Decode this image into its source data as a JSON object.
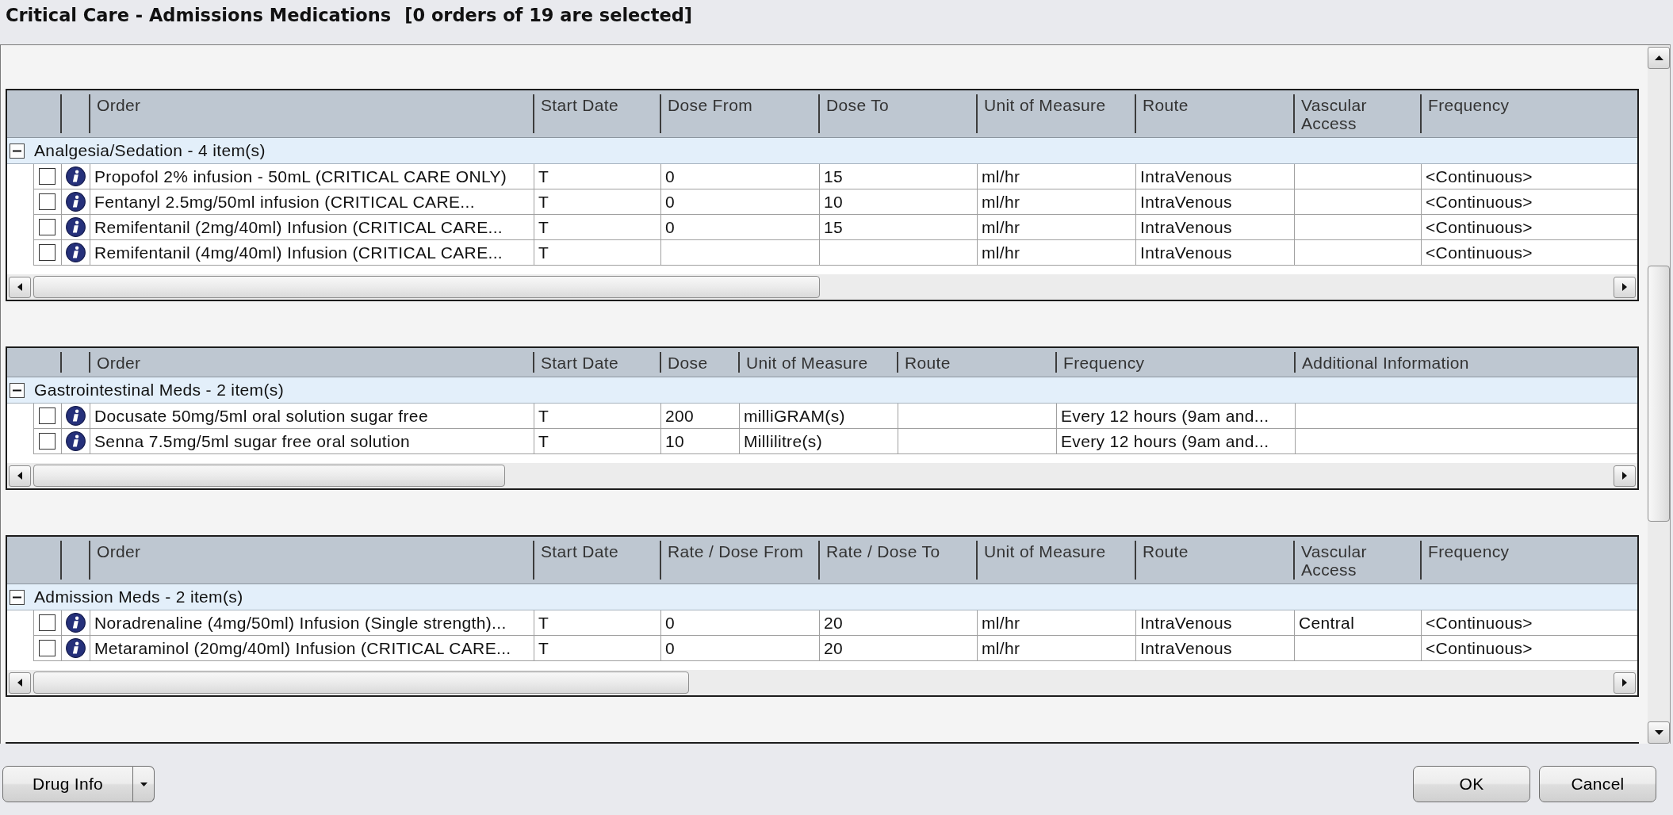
{
  "window": {
    "title": "Critical Care - Admissions Medications",
    "selection_summary": "[0 orders of 19 are selected]"
  },
  "order_tables": [
    {
      "columns": [
        "Order",
        "Start Date",
        "Dose From",
        "Dose To",
        "Unit of Measure",
        "Route",
        "Vascular Access",
        "Frequency"
      ],
      "group": {
        "label": "Analgesia/Sedation - 4 item(s)",
        "expanded": true
      },
      "rows": [
        {
          "checked": false,
          "cells": [
            "Propofol 2% infusion - 50mL (CRITICAL CARE ONLY)",
            "T",
            "0",
            "15",
            "ml/hr",
            "IntraVenous",
            null,
            "<Continuous>"
          ]
        },
        {
          "checked": false,
          "cells": [
            "Fentanyl 2.5mg/50ml infusion (CRITICAL CARE...",
            "T",
            "0",
            "10",
            "ml/hr",
            "IntraVenous",
            null,
            "<Continuous>"
          ]
        },
        {
          "checked": false,
          "cells": [
            "Remifentanil (2mg/40ml) Infusion (CRITICAL CARE...",
            "T",
            "0",
            "15",
            "ml/hr",
            "IntraVenous",
            null,
            "<Continuous>"
          ]
        },
        {
          "checked": false,
          "cells": [
            "Remifentanil (4mg/40ml) Infusion (CRITICAL CARE...",
            "T",
            null,
            null,
            "ml/hr",
            "IntraVenous",
            null,
            "<Continuous>"
          ]
        }
      ]
    },
    {
      "columns": [
        "Order",
        "Start Date",
        "Dose",
        "Unit of Measure",
        "Route",
        "Frequency",
        "Additional Information"
      ],
      "group": {
        "label": "Gastrointestinal Meds - 2 item(s)",
        "expanded": true
      },
      "rows": [
        {
          "checked": false,
          "cells": [
            "Docusate 50mg/5ml oral solution sugar free",
            "T",
            "200",
            "milliGRAM(s)",
            null,
            "Every 12 hours (9am and...",
            null
          ]
        },
        {
          "checked": false,
          "cells": [
            "Senna 7.5mg/5ml sugar free oral solution",
            "T",
            "10",
            "Millilitre(s)",
            null,
            "Every 12 hours (9am and...",
            null
          ]
        }
      ]
    },
    {
      "columns": [
        "Order",
        "Start Date",
        "Rate / Dose From",
        "Rate / Dose To",
        "Unit of Measure",
        "Route",
        "Vascular Access",
        "Frequency"
      ],
      "group": {
        "label": "Admission Meds - 2 item(s)",
        "expanded": true
      },
      "rows": [
        {
          "checked": false,
          "cells": [
            "Noradrenaline (4mg/50ml) Infusion (Single strength)...",
            "T",
            "0",
            "20",
            "ml/hr",
            "IntraVenous",
            "Central",
            "<Continuous>"
          ]
        },
        {
          "checked": false,
          "cells": [
            "Metaraminol (20mg/40ml) Infusion (CRITICAL CARE...",
            "T",
            "0",
            "20",
            "ml/hr",
            "IntraVenous",
            null,
            "<Continuous>"
          ]
        }
      ]
    }
  ],
  "footer": {
    "left": [
      {
        "label": "Drug Info",
        "kind": "split"
      }
    ],
    "right": [
      {
        "label": "OK",
        "kind": "plain"
      },
      {
        "label": "Cancel",
        "kind": "plain"
      }
    ]
  }
}
